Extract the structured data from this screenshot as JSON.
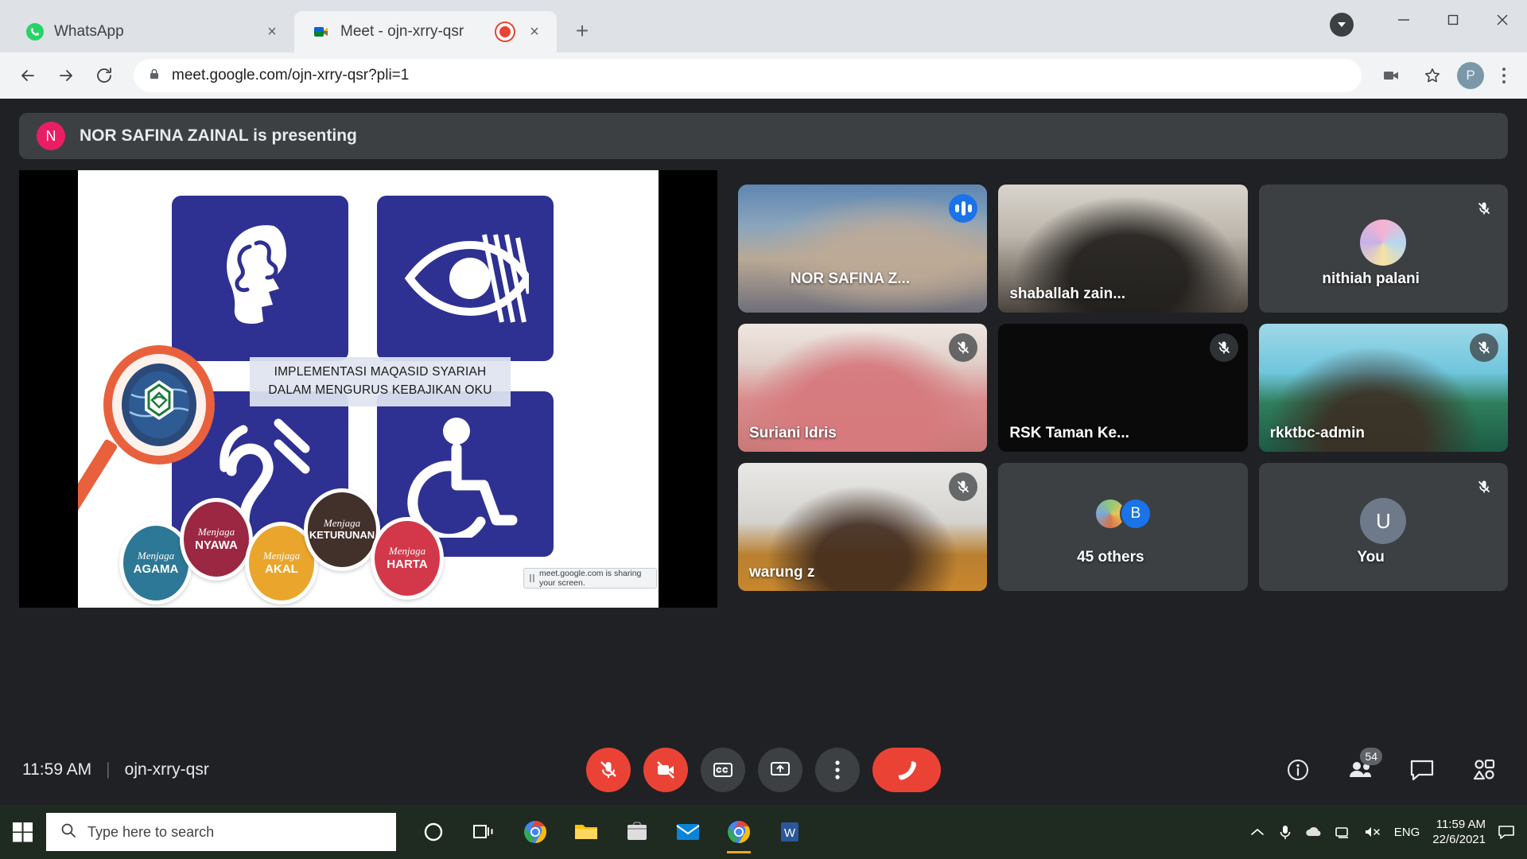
{
  "browser": {
    "tabs": [
      {
        "title": "WhatsApp",
        "favicon": "whatsapp-icon",
        "active": false
      },
      {
        "title": "Meet - ojn-xrry-qsr",
        "favicon": "google-meet-icon",
        "active": true,
        "recording": true
      }
    ],
    "new_tab_label": "+",
    "close_label": "×",
    "address": "meet.google.com/ojn-xrry-qsr?pli=1",
    "profile_initial": "P",
    "window_controls": {
      "minimize": "minimize-icon",
      "maximize": "maximize-icon",
      "close": "close-icon"
    }
  },
  "meet": {
    "presenting_banner": {
      "avatar_initial": "N",
      "text": "NOR SAFINA ZAINAL is presenting"
    },
    "slide": {
      "title_line1": "IMPLEMENTASI MAQASID SYARIAH",
      "title_line2": "DALAM MENGURUS KEBAJIKAN OKU",
      "icons": [
        "brain-head-icon",
        "eye-vision-icon",
        "hearing-ear-icon",
        "wheelchair-icon"
      ],
      "circles": [
        {
          "pre": "Menjaga",
          "main": "AGAMA",
          "color": "#2d7896"
        },
        {
          "pre": "Menjaga",
          "main": "NYAWA",
          "color": "#9c2742"
        },
        {
          "pre": "Menjaga",
          "main": "AKAL",
          "color": "#eaa62c"
        },
        {
          "pre": "Menjaga",
          "main": "KETURUNAN",
          "color": "#42302b"
        },
        {
          "pre": "Menjaga",
          "main": "HARTA",
          "color": "#d3384a"
        }
      ],
      "share_toast": "meet.google.com is sharing your screen."
    },
    "participants": [
      {
        "name": "NOR SAFINA Z...",
        "speaking": true,
        "muted": false,
        "name_position": "center"
      },
      {
        "name": "shaballah zain...",
        "speaking": false,
        "muted": false,
        "name_position": "left"
      },
      {
        "name": "nithiah palani",
        "speaking": false,
        "muted": true,
        "name_position": "center",
        "avatar": true
      },
      {
        "name": "Suriani Idris",
        "speaking": false,
        "muted": true,
        "name_position": "left"
      },
      {
        "name": "RSK Taman Ke...",
        "speaking": false,
        "muted": true,
        "name_position": "left"
      },
      {
        "name": "rkktbc-admin",
        "speaking": false,
        "muted": true,
        "name_position": "left"
      },
      {
        "name": "warung z",
        "speaking": false,
        "muted": true,
        "name_position": "left"
      },
      {
        "name": "45 others",
        "speaking": false,
        "muted": false,
        "name_position": "center",
        "group": true,
        "group_initial": "B"
      },
      {
        "name": "You",
        "speaking": false,
        "muted": true,
        "name_position": "center",
        "avatar_initial": "U"
      }
    ],
    "bottom_bar": {
      "time": "11:59 AM",
      "meeting_code": "ojn-xrry-qsr",
      "separator": "|",
      "controls": [
        {
          "name": "microphone-off-button",
          "state": "muted"
        },
        {
          "name": "camera-off-button",
          "state": "off"
        },
        {
          "name": "captions-button",
          "label": "CC"
        },
        {
          "name": "present-screen-button"
        },
        {
          "name": "more-options-button"
        },
        {
          "name": "leave-call-button"
        }
      ],
      "right_controls": [
        {
          "name": "meeting-details-button"
        },
        {
          "name": "show-everyone-button",
          "badge": "54"
        },
        {
          "name": "chat-button"
        },
        {
          "name": "activities-button"
        }
      ]
    }
  },
  "taskbar": {
    "start_label": "start-button",
    "search_placeholder": "Type here to search",
    "apps": [
      "cortana-icon",
      "task-view-icon",
      "chrome-icon",
      "file-explorer-icon",
      "microsoft-store-icon",
      "mail-icon",
      "chrome-active-icon",
      "word-icon"
    ],
    "tray": {
      "language": "ENG",
      "time": "11:59 AM",
      "date": "22/6/2021"
    }
  }
}
